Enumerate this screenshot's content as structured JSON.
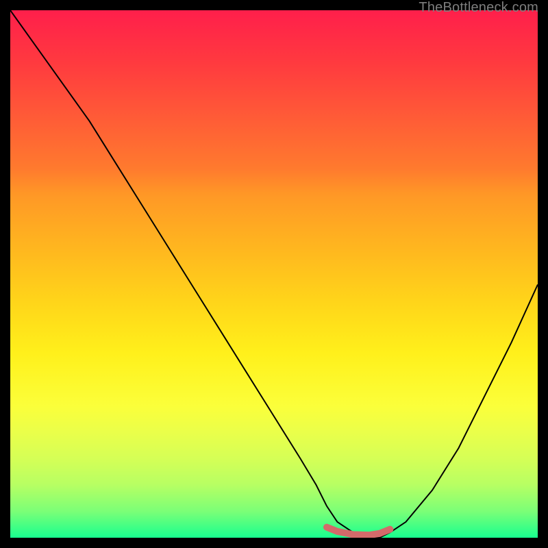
{
  "watermark": "TheBottleneck.com",
  "chart_data": {
    "type": "line",
    "title": "",
    "xlabel": "",
    "ylabel": "",
    "xlim": [
      0,
      100
    ],
    "ylim": [
      0,
      100
    ],
    "series": [
      {
        "name": "bottleneck-curve",
        "x": [
          0,
          5,
          10,
          15,
          20,
          25,
          30,
          35,
          40,
          45,
          50,
          55,
          58,
          60,
          62,
          65,
          68,
          70,
          72,
          75,
          80,
          85,
          90,
          95,
          100
        ],
        "values": [
          100,
          93,
          86,
          79,
          71,
          63,
          55,
          47,
          39,
          31,
          23,
          15,
          10,
          6,
          3,
          1,
          0,
          0,
          1,
          3,
          9,
          17,
          27,
          37,
          48
        ]
      }
    ],
    "marker_segment": {
      "name": "optimal-range",
      "color": "#d46a6a",
      "x": [
        60,
        62,
        65,
        68,
        70,
        72
      ],
      "values": [
        2,
        1.2,
        0.6,
        0.5,
        0.8,
        1.6
      ]
    },
    "background_gradient_stops": [
      {
        "pos": 0,
        "color": "#ff1f4b"
      },
      {
        "pos": 35,
        "color": "#ff9826"
      },
      {
        "pos": 65,
        "color": "#fff01b"
      },
      {
        "pos": 85,
        "color": "#d5ff56"
      },
      {
        "pos": 100,
        "color": "#18ff8f"
      }
    ]
  }
}
